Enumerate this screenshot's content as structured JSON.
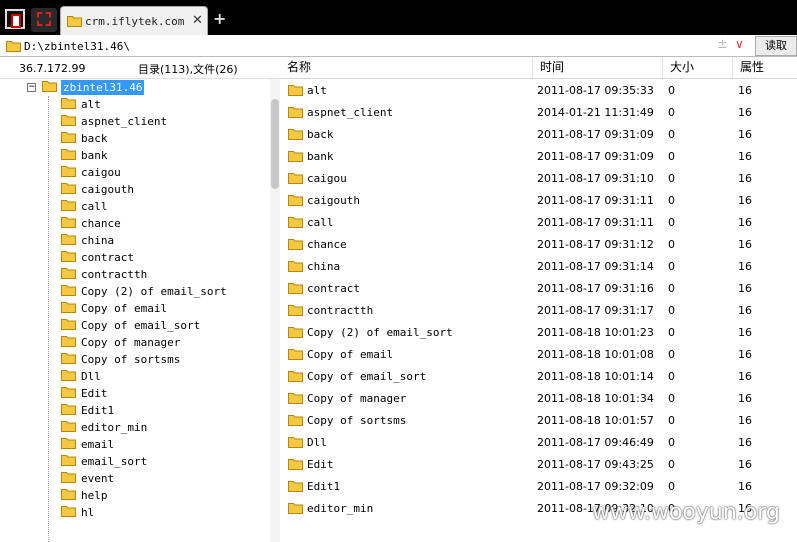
{
  "tab": {
    "title": "crm.iflytek.com",
    "close": "✕",
    "new_tab": "+"
  },
  "address": {
    "path": "D:\\zbintel31.46\\",
    "plus": "±",
    "dropdown": "∨",
    "read_label": "读取"
  },
  "info": {
    "ip": "36.7.172.99",
    "count": "目录(113),文件(26)"
  },
  "columns": {
    "name": "名称",
    "time": "时间",
    "size": "大小",
    "attr": "属性"
  },
  "tree": {
    "collapse": "−",
    "root": "zbintel31.46",
    "items": [
      "alt",
      "aspnet_client",
      "back",
      "bank",
      "caigou",
      "caigouth",
      "call",
      "chance",
      "china",
      "contract",
      "contractth",
      "Copy (2) of email_sort",
      "Copy of email",
      "Copy of email_sort",
      "Copy of manager",
      "Copy of sortsms",
      "Dll",
      "Edit",
      "Edit1",
      "editor_min",
      "email",
      "email_sort",
      "event",
      "help",
      "hl"
    ]
  },
  "files": [
    {
      "name": "alt",
      "time": "2011-08-17 09:35:33",
      "size": "0",
      "attr": "16"
    },
    {
      "name": "aspnet_client",
      "time": "2014-01-21 11:31:49",
      "size": "0",
      "attr": "16"
    },
    {
      "name": "back",
      "time": "2011-08-17 09:31:09",
      "size": "0",
      "attr": "16"
    },
    {
      "name": "bank",
      "time": "2011-08-17 09:31:09",
      "size": "0",
      "attr": "16"
    },
    {
      "name": "caigou",
      "time": "2011-08-17 09:31:10",
      "size": "0",
      "attr": "16"
    },
    {
      "name": "caigouth",
      "time": "2011-08-17 09:31:11",
      "size": "0",
      "attr": "16"
    },
    {
      "name": "call",
      "time": "2011-08-17 09:31:11",
      "size": "0",
      "attr": "16"
    },
    {
      "name": "chance",
      "time": "2011-08-17 09:31:12",
      "size": "0",
      "attr": "16"
    },
    {
      "name": "china",
      "time": "2011-08-17 09:31:14",
      "size": "0",
      "attr": "16"
    },
    {
      "name": "contract",
      "time": "2011-08-17 09:31:16",
      "size": "0",
      "attr": "16"
    },
    {
      "name": "contractth",
      "time": "2011-08-17 09:31:17",
      "size": "0",
      "attr": "16"
    },
    {
      "name": "Copy (2) of email_sort",
      "time": "2011-08-18 10:01:23",
      "size": "0",
      "attr": "16"
    },
    {
      "name": "Copy of email",
      "time": "2011-08-18 10:01:08",
      "size": "0",
      "attr": "16"
    },
    {
      "name": "Copy of email_sort",
      "time": "2011-08-18 10:01:14",
      "size": "0",
      "attr": "16"
    },
    {
      "name": "Copy of manager",
      "time": "2011-08-18 10:01:34",
      "size": "0",
      "attr": "16"
    },
    {
      "name": "Copy of sortsms",
      "time": "2011-08-18 10:01:57",
      "size": "0",
      "attr": "16"
    },
    {
      "name": "Dll",
      "time": "2011-08-17 09:46:49",
      "size": "0",
      "attr": "16"
    },
    {
      "name": "Edit",
      "time": "2011-08-17 09:43:25",
      "size": "0",
      "attr": "16"
    },
    {
      "name": "Edit1",
      "time": "2011-08-17 09:32:09",
      "size": "0",
      "attr": "16"
    },
    {
      "name": "editor_min",
      "time": "2011-08-17 09:32:10",
      "size": "0",
      "attr": "16"
    }
  ],
  "watermark": "www.wooyun.org",
  "colors": {
    "selection": "#3399ff",
    "folder": "#f5c842",
    "folder_edge": "#b8860b"
  }
}
